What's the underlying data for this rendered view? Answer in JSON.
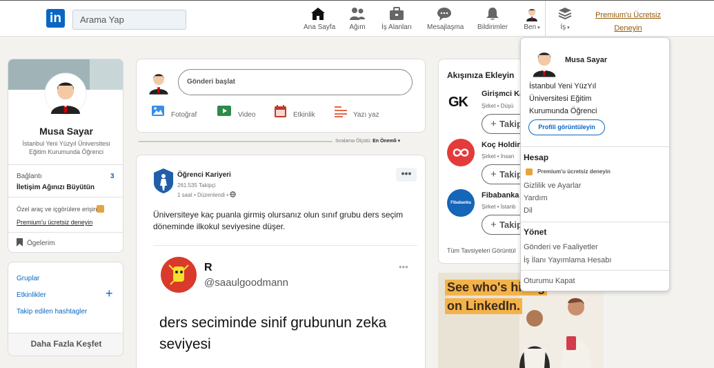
{
  "nav": {
    "search_placeholder": "Arama Yap",
    "items": [
      {
        "label": "Ana Sayfa",
        "icon": "home-icon"
      },
      {
        "label": "Ağım",
        "icon": "network-icon"
      },
      {
        "label": "İş Alanları",
        "icon": "briefcase-icon"
      },
      {
        "label": "Mesajlaşma",
        "icon": "messaging-icon"
      },
      {
        "label": "Bildirimler",
        "icon": "bell-icon"
      },
      {
        "label": "Ben",
        "icon": "avatar"
      },
      {
        "label": "İş",
        "icon": "grid-icon"
      }
    ],
    "premium_line1": "Premium'u Ücretsiz",
    "premium_line2": "Deneyin",
    "logo_text": "in"
  },
  "profile": {
    "name": "Musa Sayar",
    "headline": "İstanbul Yeni Yüzyıl Üniversitesi Eğitim Kurumunda Öğrenci",
    "connections_label": "Bağlantı",
    "connections_count": "3",
    "grow_network": "İletişim Ağınızı Büyütün",
    "exclusive_tools": "Özel araç ve içgörülere erişin",
    "premium_try": "Premium'u ücretsiz deneyin",
    "saved_items": "Ögelerim"
  },
  "left_links": {
    "groups": "Gruplar",
    "events": "Etkinlikler",
    "hashtags": "Takip edilen hashtagler",
    "discover_more": "Daha Fazla Keşfet"
  },
  "composer": {
    "start_post": "Gönderi başlat",
    "photo": "Fotoğraf",
    "video": "Video",
    "event": "Etkinlik",
    "write_article": "Yazı yaz",
    "sort_label": "Sıralama Ölçütü:",
    "sort_value": "En Önemli"
  },
  "post": {
    "author": "Öğrenci Kariyeri",
    "followers": "261.535 Takipçi",
    "meta": "1 saat • Düzenlendi •",
    "text": "Üniversiteye kaç puanla girmiş olursanız olun sınıf grubu ders seçim döneminde ilkokul seviyesine düşer.",
    "embed_name": "R",
    "embed_handle": "@saaulgoodmann",
    "embed_text": "ders seciminde sinif grubunun zeka seviyesi"
  },
  "suggestions": {
    "title": "Akışınıza Ekleyin",
    "items": [
      {
        "name": "Girişmci Ka",
        "sub": "Şirket • Düşü",
        "follow": "Takip"
      },
      {
        "name": "Koç Holdin",
        "sub": "Şirket • İnsan",
        "follow": "Takip"
      },
      {
        "name": "Fibabanka",
        "sub": "Şirket • İstanb",
        "follow": "Takip"
      }
    ],
    "all_recommendations": "Tüm Tavsiyeleri Görüntül",
    "gk_logo_text": "GK",
    "fiba_logo_text": "Fibabanka"
  },
  "ad": {
    "line1": "See who's hiring",
    "line2": "on LinkedIn."
  },
  "dropdown": {
    "name": "Musa Sayar",
    "headline_l1": "İstanbul Yeni YüzYıl",
    "headline_l2": "Üniversitesi Eğitim",
    "headline_l3": "Kurumunda Öğrenci",
    "view_profile": "Profili görüntüleyin",
    "account_heading": "Hesap",
    "premium": "Premium'u ücretsiz deneyin",
    "privacy": "Gizlilik ve Ayarlar",
    "help": "Yardım",
    "language": "Dil",
    "manage_heading": "Yönet",
    "posts_activity": "Gönderi ve Faaliyetler",
    "job_posting": "İş İlanı Yayımlama Hesabı",
    "sign_out": "Oturumu Kapat"
  },
  "colors": {
    "brand": "#0a66c2",
    "premium": "#915907",
    "premium_badge": "#e7a33e"
  }
}
